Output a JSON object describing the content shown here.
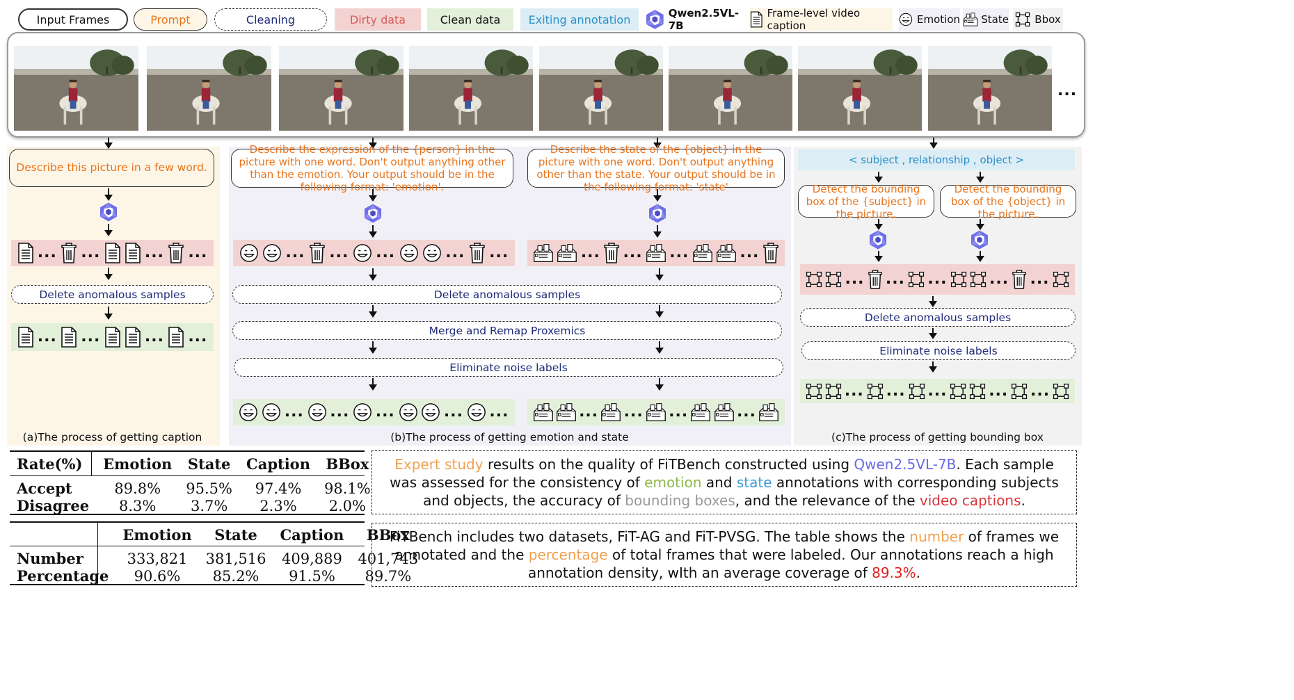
{
  "legend": {
    "input_frames": "Input Frames",
    "prompt": "Prompt",
    "cleaning": "Cleaning",
    "dirty_data": "Dirty data",
    "clean_data": "Clean data",
    "existing_annotation": "Exiting annotation",
    "model": "Qwen2.5VL-7B",
    "caption": "Frame-level video caption",
    "emotion": "Emotion",
    "state": "State",
    "bbox": "Bbox"
  },
  "colors": {
    "prompt_orange": "#e8741c",
    "step_blue": "#1e2a78",
    "dirty_bg": "#f3d3d1",
    "clean_bg": "#e2efd9",
    "annotation_bg": "#dcedf5",
    "panel_a_bg": "#fdf6e7",
    "panel_b_bg": "#f1f0f7",
    "panel_c_bg": "#f2f2f2",
    "model_purple": "#5b5bd6"
  },
  "frames_ellipsis": "...",
  "dots": "...",
  "panel_a": {
    "prompt": "Describe this picture in a few word.",
    "delete": "Delete  anomalous samples",
    "caption": "(a)The process of getting caption"
  },
  "panel_b": {
    "prompt_emotion": "Describe the expression of the {person} in the picture with one word. Don't output anything other than the emotion. Your output should be in the following format: 'emotion'.",
    "prompt_state": "Describe the state of the {object} in the picture with one word. Don't output anything other than the state. Your output should be in the following format: 'state'",
    "delete": "Delete  anomalous samples",
    "merge": "Merge and Remap Proxemics",
    "eliminate": "Eliminate noise labels",
    "caption": "(b)The process of getting emotion and state"
  },
  "panel_c": {
    "triplet": "< subject , relationship , object >",
    "prompt_subject": "Detect the bounding box of the {subject} in the picture.",
    "prompt_object": "Detect the bounding box of the {object}  in the picture.",
    "delete": "Delete  anomalous samples",
    "eliminate": "Eliminate noise labels",
    "caption": "(c)The process of getting bounding box"
  },
  "table1": {
    "headers": [
      "Rate(%)",
      "Emotion",
      "State",
      "Caption",
      "BBox"
    ],
    "rows": [
      [
        "Accept",
        "89.8%",
        "95.5%",
        "97.4%",
        "98.1%"
      ],
      [
        "Disagree",
        "8.3%",
        "3.7%",
        "2.3%",
        "2.0%"
      ]
    ]
  },
  "table2": {
    "headers": [
      "",
      "Emotion",
      "State",
      "Caption",
      "BBox"
    ],
    "rows": [
      [
        "Number",
        "333,821",
        "381,516",
        "409,889",
        "401,743"
      ],
      [
        "Percentage",
        "90.6%",
        "85.2%",
        "91.5%",
        "89.7%"
      ]
    ]
  },
  "note1": {
    "p1": "Expert study",
    "p2": " results on the quality of FiTBench constructed using ",
    "p3": "Qwen2.5VL-7B",
    "p4": ". Each sample was assessed for the consistency of ",
    "p5": "emotion",
    "p6": " and ",
    "p7": "state",
    "p8": " annotations with corresponding subjects and objects, the accuracy of ",
    "p9": "bounding boxes",
    "p10": ", and the relevance of the ",
    "p11": "video captions",
    "p12": "."
  },
  "note2": {
    "p1": "FiTBench includes two datasets, FiT-AG and FiT-PVSG. The table shows the ",
    "p2": "number",
    "p3": " of frames we annotated and the ",
    "p4": "percentage",
    "p5": " of total frames that were labeled. Our annotations reach a high annotation density, wIth an average coverage of ",
    "p6": "89.3%",
    "p7": "."
  }
}
